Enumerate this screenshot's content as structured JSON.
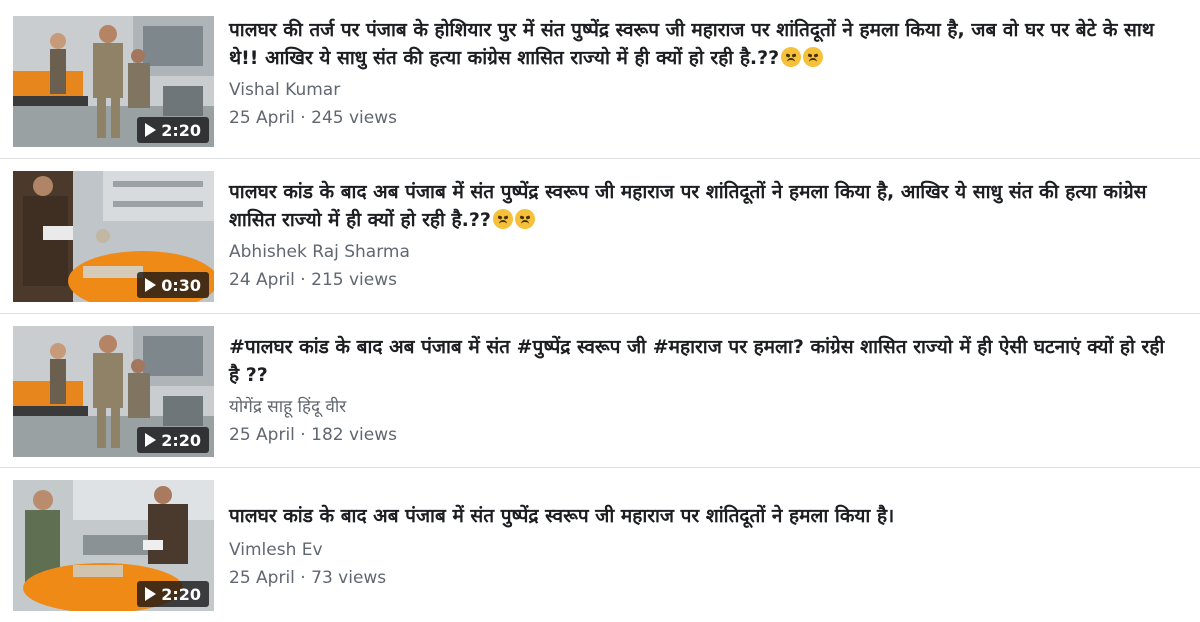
{
  "videos": [
    {
      "title": "पालघर की तर्ज पर पंजाब के होशियार पुर में संत पुष्पेंद्र स्वरूप जी महाराज पर शांतिदूतों ने हमला किया है, जब वो घर पर बेटे के साथ थे!! आखिर ये साधु संत की हत्या कांग्रेस शासित राज्यो में ही क्यों हो रही है.??",
      "emoji_count": 2,
      "author": "Vishal Kumar",
      "date": "25 April",
      "views": "245 views",
      "duration": "2:20",
      "thumb_icon": "hospital-scene-icon"
    },
    {
      "title": "पालघर कांड के बाद अब पंजाब में संत पुष्पेंद्र स्वरूप जी महाराज पर शांतिदूतों ने हमला किया है, आखिर ये साधु संत की हत्या कांग्रेस शासित राज्यो में ही क्यों हो रही है.??",
      "emoji_count": 2,
      "author": "Abhishek Raj Sharma",
      "date": "24 April",
      "views": "215 views",
      "duration": "0:30",
      "thumb_icon": "hospital-scene-icon"
    },
    {
      "title": "#पालघर कांड के बाद अब पंजाब में संत #पुष्पेंद्र स्वरूप जी #महाराज पर हमला? कांग्रेस शासित राज्यो में ही ऐसी घटनाएं क्यों हो रही है ??",
      "emoji_count": 0,
      "author": "योगेंद्र साहू हिंदू वीर",
      "date": "25 April",
      "views": "182 views",
      "duration": "2:20",
      "thumb_icon": "hospital-scene-icon"
    },
    {
      "title": "पालघर कांड के बाद अब पंजाब में संत पुष्पेंद्र स्वरूप जी महाराज पर शांतिदूतों ने हमला किया है।",
      "emoji_count": 0,
      "author": "Vimlesh Ev",
      "date": "25 April",
      "views": "73 views",
      "duration": "2:20",
      "thumb_icon": "hospital-scene-icon"
    }
  ],
  "separator": " · ",
  "colors": {
    "title": "#1c1e21",
    "meta": "#606770",
    "divider": "#dcdee2",
    "robe": "#f28a1c"
  }
}
